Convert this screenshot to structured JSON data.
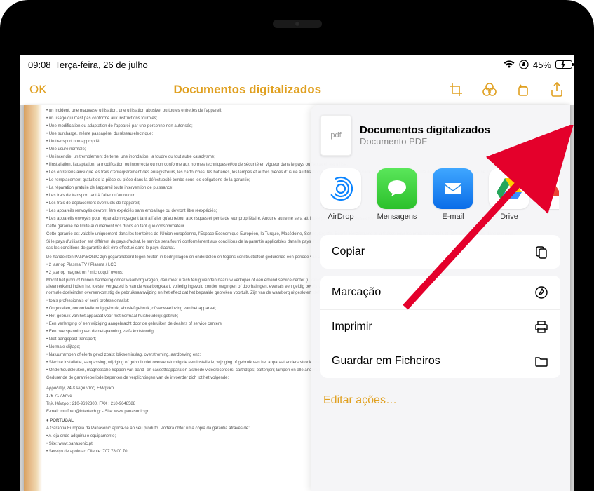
{
  "status_bar": {
    "time": "09:08",
    "date": "Terça-feira, 26 de julho",
    "battery_percent": "45%"
  },
  "nav": {
    "ok": "OK",
    "title": "Documentos digitalizados"
  },
  "share_sheet": {
    "doc_title": "Documentos digitalizados",
    "doc_type": "Documento PDF",
    "pdf_badge": "pdf",
    "apps": {
      "airdrop": "AirDrop",
      "messages": "Mensagens",
      "email": "E-mail",
      "drive": "Drive"
    },
    "actions": {
      "copy": "Copiar",
      "markup": "Marcação",
      "print": "Imprimir",
      "save_files": "Guardar em Ficheiros"
    },
    "edit": "Editar ações…"
  },
  "document_body_sample": "Garantia Europeia da Panasonic aplica-se ao seu produto. Poderá obter uma cópia da garantia através de… PORTUGAL — Serviço de apoio ao Cliente: 707 78 00 70 — www.panasonic.pt"
}
